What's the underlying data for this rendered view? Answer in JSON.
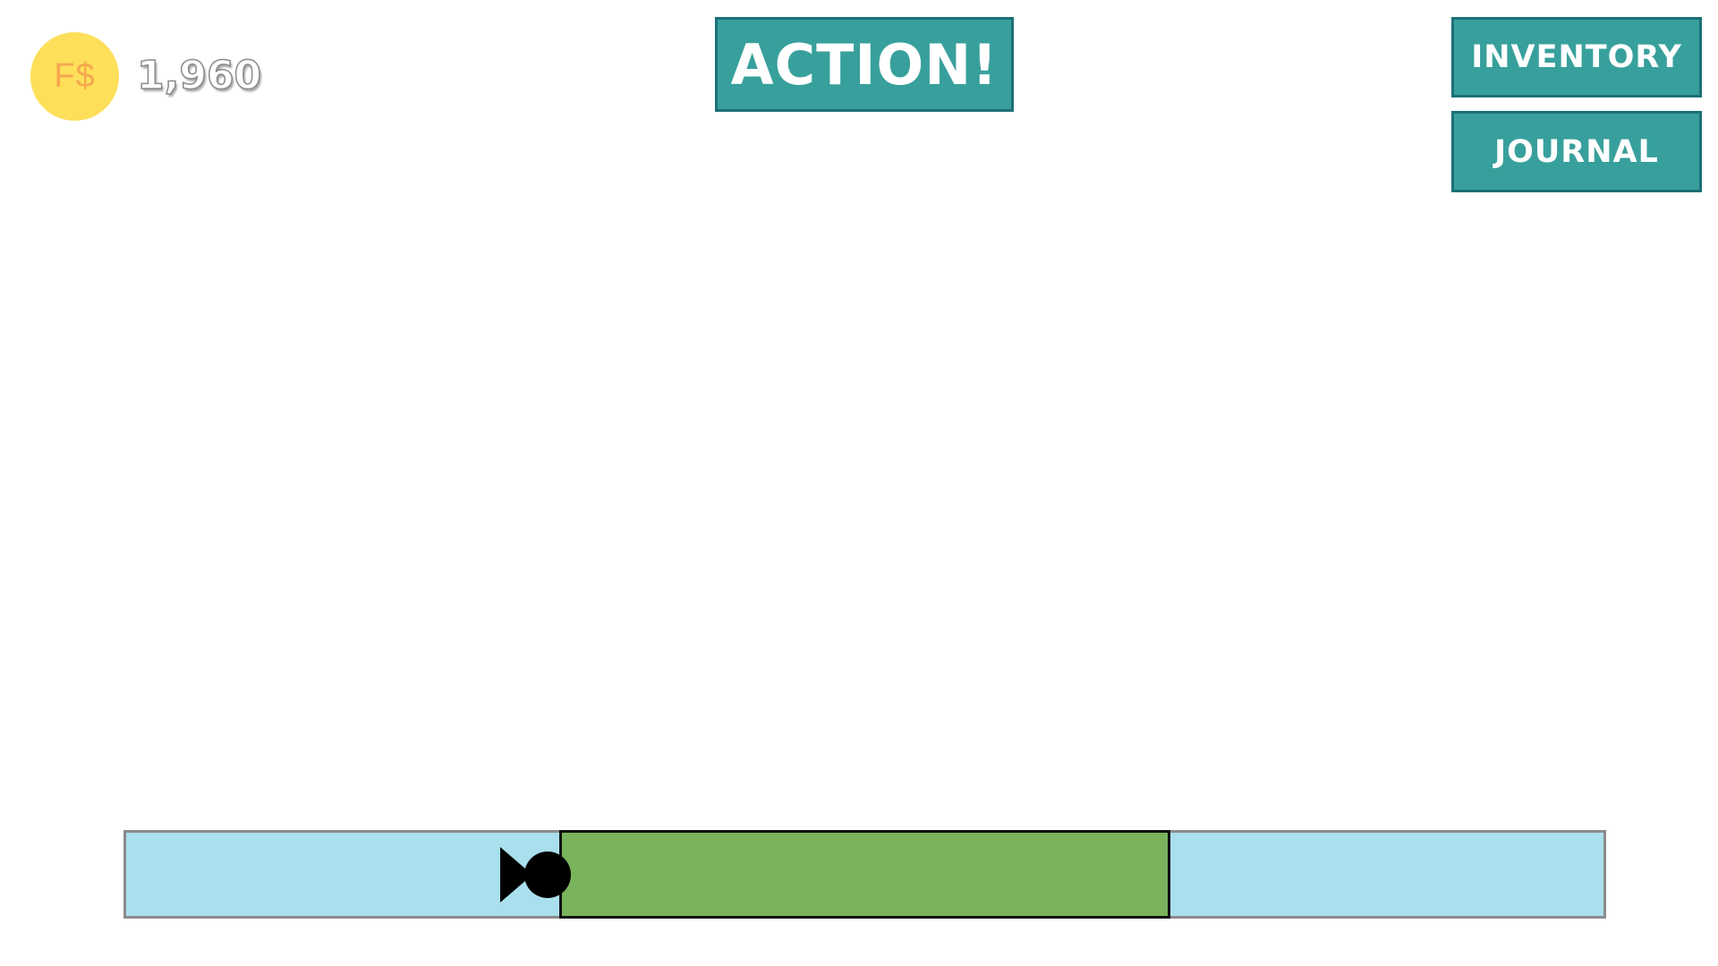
{
  "hud": {
    "currency_symbol": "F$",
    "balance": "1,960"
  },
  "buttons": {
    "action_label": "ACTION!",
    "inventory_label": "INVENTORY",
    "journal_label": "JOURNAL"
  },
  "timing_meter": {
    "target_zone_start": 0.293,
    "target_zone_end": 0.707,
    "marker_position": 0.253,
    "colors": {
      "track": "#aadfee",
      "target_zone": "#79b35c",
      "marker": "#000000"
    }
  },
  "colors": {
    "button_fill": "#38a09c",
    "button_border": "#1d6f78",
    "coin": "#fedf5a",
    "coin_text": "#f6a84e"
  }
}
